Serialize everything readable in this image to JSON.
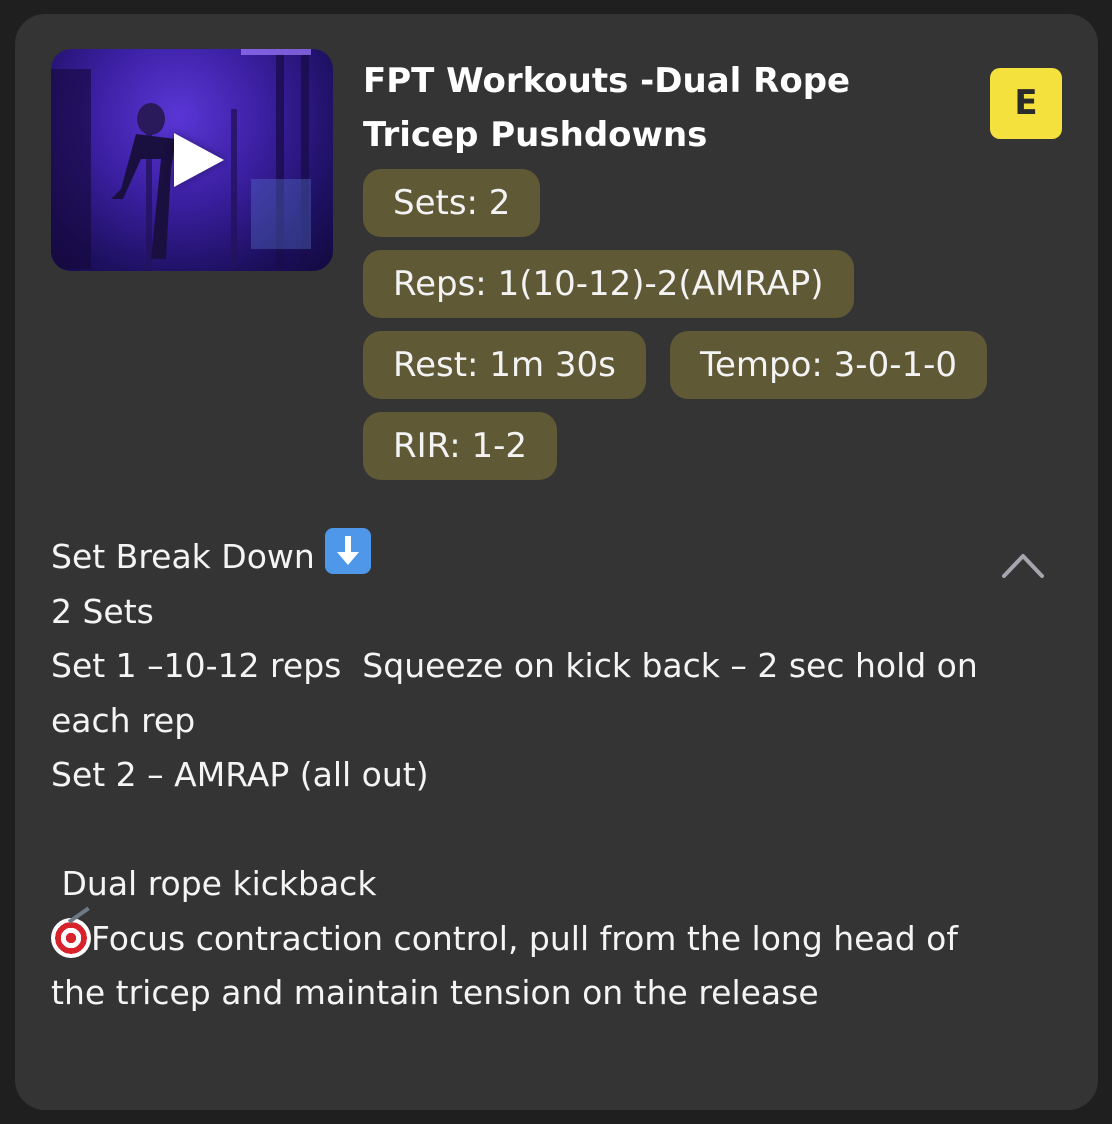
{
  "card": {
    "title": "FPT Workouts -Dual Rope Tricep Pushdowns",
    "badge": "E",
    "thumbnail_icon": "play-icon",
    "chips": {
      "sets": "Sets: 2",
      "reps": "Reps: 1(10-12)-2(AMRAP)",
      "rest": "Rest: 1m 30s",
      "tempo": "Tempo: 3-0-1-0",
      "rir": "RIR: 1-2"
    },
    "details": {
      "heading": "Set Break Down",
      "heading_icon": "down-arrow-icon",
      "line_sets": "2 Sets",
      "line_set1": "Set 1 –10-12 reps  Squeeze on kick back – 2 sec hold on each rep",
      "line_set2": "Set 2 – AMRAP (all out)",
      "exercise": " Dual rope kickback",
      "focus_icon": "target-icon",
      "focus": "Focus contraction control, pull from the long head of the tricep and maintain tension on the release"
    },
    "collapse_icon": "chevron-up-icon",
    "colors": {
      "card_bg": "#343434",
      "chip_bg": "#5f5936",
      "badge_bg": "#f4e13e"
    }
  }
}
